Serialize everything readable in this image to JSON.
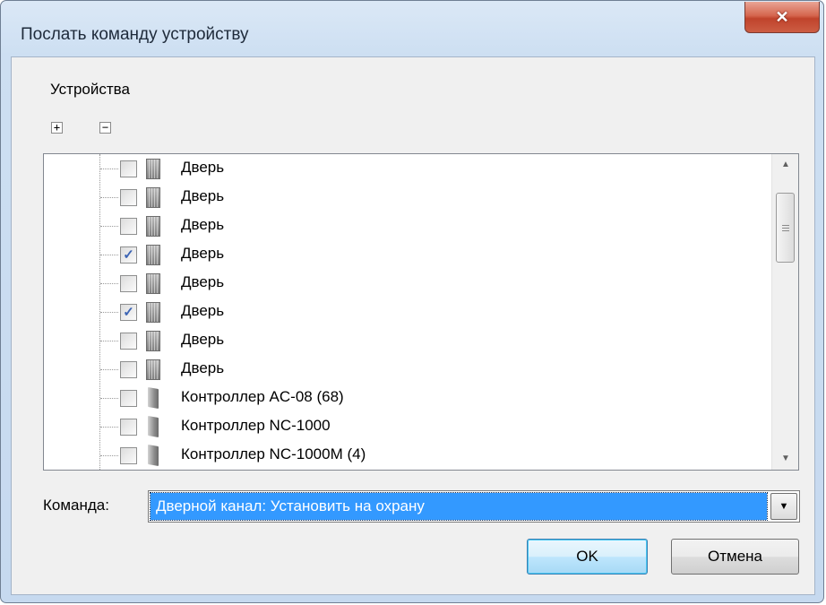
{
  "window": {
    "title": "Послать команду устройству",
    "close_glyph": "✕"
  },
  "devices": {
    "label": "Устройства",
    "expand_glyph": "+",
    "collapse_glyph": "−",
    "rows": [
      {
        "label": "Дверь",
        "checked": false,
        "icon": "door-icon"
      },
      {
        "label": "Дверь",
        "checked": false,
        "icon": "door-icon"
      },
      {
        "label": "Дверь",
        "checked": false,
        "icon": "door-icon"
      },
      {
        "label": "Дверь",
        "checked": true,
        "icon": "door-icon"
      },
      {
        "label": "Дверь",
        "checked": false,
        "icon": "door-icon"
      },
      {
        "label": "Дверь",
        "checked": true,
        "icon": "door-icon"
      },
      {
        "label": "Дверь",
        "checked": false,
        "icon": "door-icon"
      },
      {
        "label": "Дверь",
        "checked": false,
        "icon": "door-icon"
      },
      {
        "label": "Контроллер AC-08 (68)",
        "checked": false,
        "icon": "controller-icon"
      },
      {
        "label": "Контроллер NC-1000",
        "checked": false,
        "icon": "controller-icon"
      },
      {
        "label": "Контроллер NC-1000M (4)",
        "checked": false,
        "icon": "controller-icon"
      }
    ]
  },
  "command": {
    "label": "Команда:",
    "value": "Дверной канал: Установить на охрану"
  },
  "buttons": {
    "ok": "OK",
    "cancel": "Отмена"
  },
  "colors": {
    "selection": "#3399ff",
    "close_button": "#c74a32"
  }
}
